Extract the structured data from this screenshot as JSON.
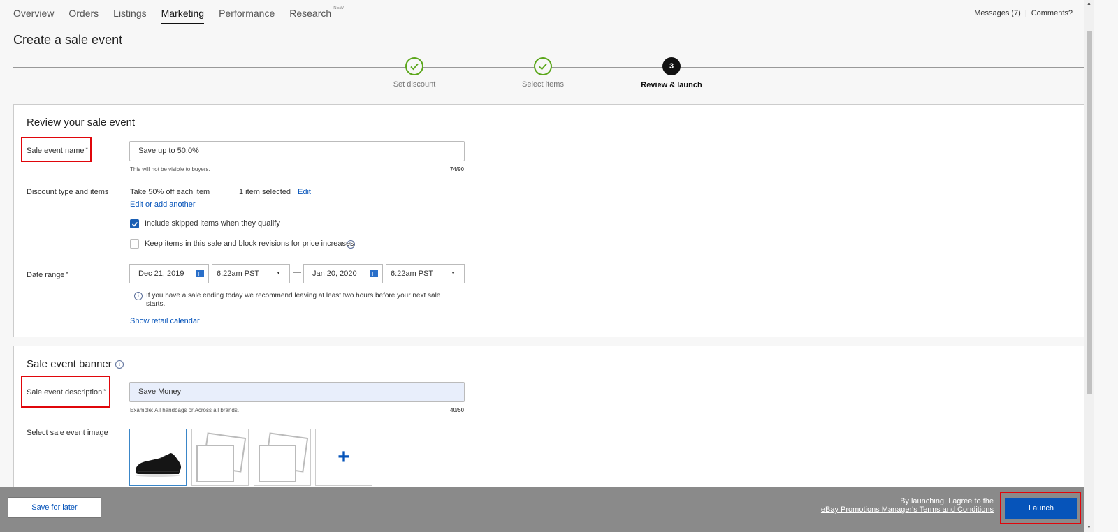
{
  "nav": {
    "tabs": [
      {
        "label": "Overview"
      },
      {
        "label": "Orders"
      },
      {
        "label": "Listings"
      },
      {
        "label": "Marketing",
        "active": true
      },
      {
        "label": "Performance"
      },
      {
        "label": "Research",
        "badge": "NEW"
      }
    ],
    "messages": "Messages (7)",
    "separator": "|",
    "comments": "Comments?"
  },
  "page_title": "Create a sale event",
  "stepper": {
    "steps": [
      {
        "label": "Set discount",
        "state": "done"
      },
      {
        "label": "Select items",
        "state": "done"
      },
      {
        "label": "Review & launch",
        "state": "current",
        "number": "3"
      }
    ]
  },
  "review": {
    "heading": "Review your sale event",
    "name_label": "Sale event name",
    "required_mark": "*",
    "name_value": "Save up to 50.0%",
    "name_hint": "This will not be visible to buyers.",
    "name_counter": "74/90",
    "discount_label": "Discount type and items",
    "discount_text": "Take 50% off each item",
    "items_selected": "1 item selected",
    "edit_link": "Edit",
    "edit_add_link": "Edit or add another",
    "include_skipped": {
      "label": "Include skipped items when they qualify",
      "checked": true
    },
    "keep_items": {
      "label": "Keep items in this sale and block revisions for price increases",
      "checked": false
    },
    "date_label": "Date range",
    "start_date": "Dec 21, 2019",
    "start_time": "6:22am PST",
    "dash": "—",
    "end_date": "Jan 20, 2020",
    "end_time": "6:22am PST",
    "info_line1": "If you have a sale ending today we recommend leaving at least two hours before your next sale",
    "info_line2": "starts.",
    "retail_calendar_link": "Show retail calendar"
  },
  "banner": {
    "heading": "Sale event banner",
    "desc_label": "Sale event description",
    "desc_value": "Save Money",
    "desc_hint": "Example: All handbags or Across all brands.",
    "desc_counter": "40/50",
    "image_label": "Select sale event image"
  },
  "footer": {
    "save_label": "Save for later",
    "terms_line1": "By launching, I agree to the",
    "terms_link": "eBay Promotions Manager's Terms and Conditions",
    "launch_label": "Launch"
  },
  "colors": {
    "accent": "#0654ba",
    "success": "#5ba71b",
    "highlight": "#e0060b",
    "footer_bg": "#8a8a8a"
  }
}
